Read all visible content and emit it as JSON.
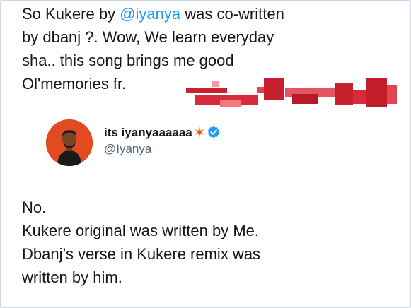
{
  "quoted_tweet": {
    "text_before": "So Kukere by ",
    "mention": "@iyanya",
    "text_after": " was co-written\nby dbanj ?. Wow, We learn everyday\nsha.. this song brings me good\nOl'memories fr."
  },
  "reply_tweet": {
    "display_name": "its iyanyaaaaaa",
    "name_emoji_icon": "collision-sparkle-icon",
    "verified_icon": "verified-badge-icon",
    "handle": "@Iyanya",
    "text": "No.\nKukere original was written by Me.\nDbanj’s verse in Kukere remix was\nwritten by him."
  },
  "colors": {
    "mention": "#1d9bf0",
    "verified": "#1d9bf0",
    "redaction": "#d62b3a",
    "avatar_bg": "#e24a1f"
  }
}
